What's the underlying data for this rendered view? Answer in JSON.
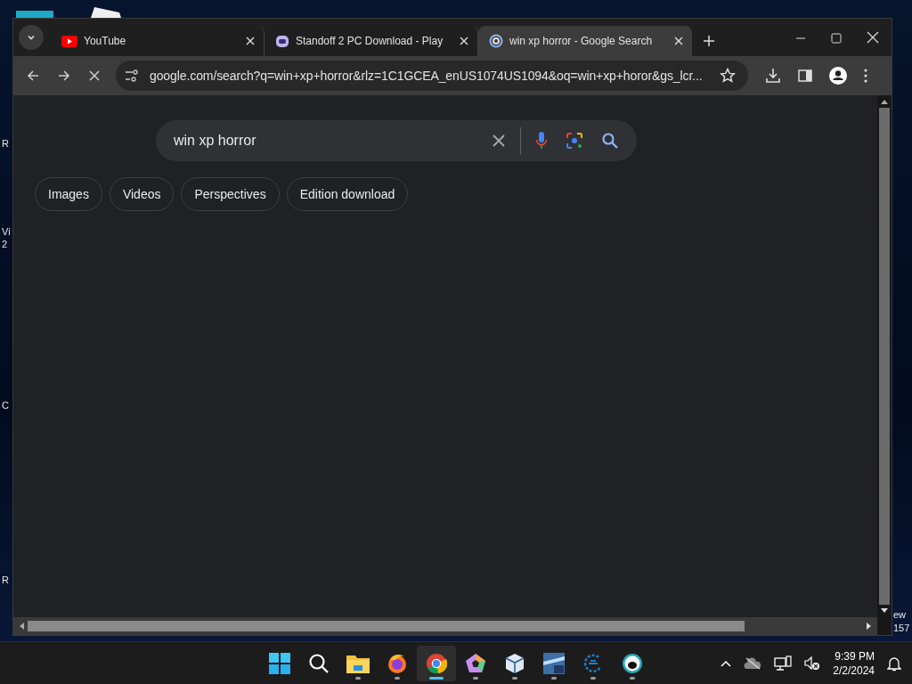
{
  "desktop": {
    "left_labels": [
      "R",
      "Vi",
      "2",
      "C",
      "R"
    ],
    "right_labels": [
      "ew",
      "157"
    ]
  },
  "browser": {
    "tabs": [
      {
        "title": "YouTube",
        "kind": "youtube",
        "selected": false
      },
      {
        "title": "Standoff 2 PC Download - Play",
        "kind": "game",
        "selected": false
      },
      {
        "title": "win xp horror - Google Search",
        "kind": "google",
        "selected": true
      }
    ],
    "toolbar": {
      "loading": true,
      "url": "google.com/search?q=win+xp+horror&rlz=1C1GCEA_enUS1074US1094&oq=win+xp+horor&gs_lcr..."
    },
    "search": {
      "value": "win xp horror"
    },
    "chips": [
      "Images",
      "Videos",
      "Perspectives",
      "Edition download"
    ]
  },
  "taskbar": {
    "apps": [
      {
        "kind": "start",
        "running": false,
        "selected": false
      },
      {
        "kind": "search",
        "running": false,
        "selected": false
      },
      {
        "kind": "folder",
        "running": true,
        "selected": false
      },
      {
        "kind": "firefox",
        "running": true,
        "selected": false
      },
      {
        "kind": "chrome",
        "running": true,
        "selected": true
      },
      {
        "kind": "pentagon",
        "running": true,
        "selected": false
      },
      {
        "kind": "cube",
        "running": true,
        "selected": false
      },
      {
        "kind": "ninetyfive",
        "running": true,
        "selected": false
      },
      {
        "kind": "swirl",
        "running": true,
        "selected": false
      },
      {
        "kind": "face",
        "running": true,
        "selected": false
      }
    ],
    "time": "9:39 PM",
    "date": "2/2/2024"
  }
}
